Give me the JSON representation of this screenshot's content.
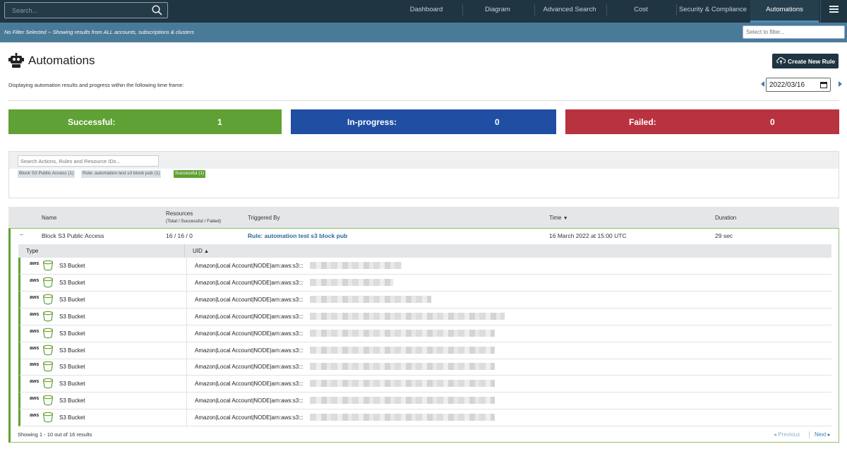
{
  "nav": {
    "search_placeholder": "Search...",
    "items": [
      {
        "label": "Dashboard"
      },
      {
        "label": "Diagram"
      },
      {
        "label": "Advanced Search"
      },
      {
        "label": "Cost"
      },
      {
        "label": "Security & Compliance"
      },
      {
        "label": "Automations"
      }
    ],
    "active": "Automations"
  },
  "filterbar": {
    "text": "No Filter Selected -- Showing results from ALL accounts, subscriptions & clusters",
    "placeholder": "Select to filter..."
  },
  "header": {
    "title": "Automations",
    "create_button": "Create New Rule",
    "timeframe_text": "Displaying automation results and progress within the following time frame:",
    "date": "2022/03/16"
  },
  "stats": {
    "successful_label": "Successful:",
    "successful_value": "1",
    "inprogress_label": "In-progress:",
    "inprogress_value": "0",
    "failed_label": "Failed:",
    "failed_value": "0"
  },
  "filters": {
    "search_placeholder": "Search Actions, Rules and Resource IDs...",
    "tags": [
      "Block S3 Public Access (1)",
      "Rule: automation test s3 block pub (1)",
      "Successful (1)"
    ]
  },
  "table": {
    "headers": {
      "name": "Name",
      "resources": "Resources",
      "resources_sub": "(Total / Successful / Failed)",
      "triggered": "Triggered By",
      "time": "Time",
      "duration": "Duration"
    },
    "row": {
      "name": "Block S3 Public Access",
      "resources": "16 / 16 / 0",
      "triggered": "Rule: automation test s3 block pub",
      "time": "16 March 2022 at 15:00 UTC",
      "duration": "29 sec"
    },
    "sub_headers": {
      "type": "Type",
      "uid": "UID"
    },
    "sub_rows": [
      {
        "type": "S3 Bucket",
        "uid": "Amazon|Local Account|NODE|arn:aws:s3:::"
      },
      {
        "type": "S3 Bucket",
        "uid": "Amazon|Local Account|NODE|arn:aws:s3:::"
      },
      {
        "type": "S3 Bucket",
        "uid": "Amazon|Local Account|NODE|arn:aws:s3:::"
      },
      {
        "type": "S3 Bucket",
        "uid": "Amazon|Local Account|NODE|arn:aws:s3:::"
      },
      {
        "type": "S3 Bucket",
        "uid": "Amazon|Local Account|NODE|arn:aws:s3:::"
      },
      {
        "type": "S3 Bucket",
        "uid": "Amazon|Local Account|NODE|arn:aws:s3:::"
      },
      {
        "type": "S3 Bucket",
        "uid": "Amazon|Local Account|NODE|arn:aws:s3:::"
      },
      {
        "type": "S3 Bucket",
        "uid": "Amazon|Local Account|NODE|arn:aws:s3:::"
      },
      {
        "type": "S3 Bucket",
        "uid": "Amazon|Local Account|NODE|arn:aws:s3:::"
      },
      {
        "type": "S3 Bucket",
        "uid": "Amazon|Local Account|NODE|arn:aws:s3:::"
      }
    ],
    "aws_label": "aws",
    "footer": "Showing 1 - 10 out of 16 results",
    "prev": "Previous",
    "next": "Next"
  },
  "colors": {
    "success": "#5fa134",
    "progress": "#1f4ea3",
    "failed": "#b9323f",
    "nav": "#1f3542"
  }
}
